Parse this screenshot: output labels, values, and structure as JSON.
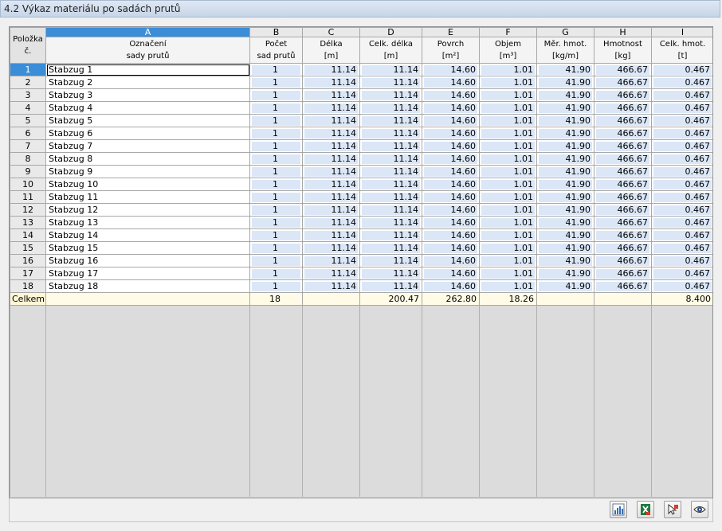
{
  "title": "4.2 Výkaz materiálu po sadách prutů",
  "columns": {
    "letters": [
      "A",
      "B",
      "C",
      "D",
      "E",
      "F",
      "G",
      "H",
      "I"
    ],
    "row_header": {
      "line1": "Položka",
      "line2": "č."
    },
    "headers": [
      {
        "line1": "Označení",
        "line2": "sady prutů"
      },
      {
        "line1": "Počet",
        "line2": "sad prutů"
      },
      {
        "line1": "Délka",
        "line2": "[m]"
      },
      {
        "line1": "Celk. délka",
        "line2": "[m]"
      },
      {
        "line1": "Povrch",
        "line2": "[m²]"
      },
      {
        "line1": "Objem",
        "line2": "[m³]"
      },
      {
        "line1": "Měr. hmot.",
        "line2": "[kg/m]"
      },
      {
        "line1": "Hmotnost",
        "line2": "[kg]"
      },
      {
        "line1": "Celk. hmot.",
        "line2": "[t]"
      }
    ]
  },
  "rows": [
    {
      "no": "1",
      "name": "Stabzug 1",
      "count": "1",
      "length": "11.14",
      "total_length": "11.14",
      "surface": "14.60",
      "volume": "1.01",
      "unit_weight": "41.90",
      "weight": "466.67",
      "total_weight": "0.467"
    },
    {
      "no": "2",
      "name": "Stabzug 2",
      "count": "1",
      "length": "11.14",
      "total_length": "11.14",
      "surface": "14.60",
      "volume": "1.01",
      "unit_weight": "41.90",
      "weight": "466.67",
      "total_weight": "0.467"
    },
    {
      "no": "3",
      "name": "Stabzug 3",
      "count": "1",
      "length": "11.14",
      "total_length": "11.14",
      "surface": "14.60",
      "volume": "1.01",
      "unit_weight": "41.90",
      "weight": "466.67",
      "total_weight": "0.467"
    },
    {
      "no": "4",
      "name": "Stabzug 4",
      "count": "1",
      "length": "11.14",
      "total_length": "11.14",
      "surface": "14.60",
      "volume": "1.01",
      "unit_weight": "41.90",
      "weight": "466.67",
      "total_weight": "0.467"
    },
    {
      "no": "5",
      "name": "Stabzug 5",
      "count": "1",
      "length": "11.14",
      "total_length": "11.14",
      "surface": "14.60",
      "volume": "1.01",
      "unit_weight": "41.90",
      "weight": "466.67",
      "total_weight": "0.467"
    },
    {
      "no": "6",
      "name": "Stabzug 6",
      "count": "1",
      "length": "11.14",
      "total_length": "11.14",
      "surface": "14.60",
      "volume": "1.01",
      "unit_weight": "41.90",
      "weight": "466.67",
      "total_weight": "0.467"
    },
    {
      "no": "7",
      "name": "Stabzug 7",
      "count": "1",
      "length": "11.14",
      "total_length": "11.14",
      "surface": "14.60",
      "volume": "1.01",
      "unit_weight": "41.90",
      "weight": "466.67",
      "total_weight": "0.467"
    },
    {
      "no": "8",
      "name": "Stabzug 8",
      "count": "1",
      "length": "11.14",
      "total_length": "11.14",
      "surface": "14.60",
      "volume": "1.01",
      "unit_weight": "41.90",
      "weight": "466.67",
      "total_weight": "0.467"
    },
    {
      "no": "9",
      "name": "Stabzug 9",
      "count": "1",
      "length": "11.14",
      "total_length": "11.14",
      "surface": "14.60",
      "volume": "1.01",
      "unit_weight": "41.90",
      "weight": "466.67",
      "total_weight": "0.467"
    },
    {
      "no": "10",
      "name": "Stabzug 10",
      "count": "1",
      "length": "11.14",
      "total_length": "11.14",
      "surface": "14.60",
      "volume": "1.01",
      "unit_weight": "41.90",
      "weight": "466.67",
      "total_weight": "0.467"
    },
    {
      "no": "11",
      "name": "Stabzug 11",
      "count": "1",
      "length": "11.14",
      "total_length": "11.14",
      "surface": "14.60",
      "volume": "1.01",
      "unit_weight": "41.90",
      "weight": "466.67",
      "total_weight": "0.467"
    },
    {
      "no": "12",
      "name": "Stabzug 12",
      "count": "1",
      "length": "11.14",
      "total_length": "11.14",
      "surface": "14.60",
      "volume": "1.01",
      "unit_weight": "41.90",
      "weight": "466.67",
      "total_weight": "0.467"
    },
    {
      "no": "13",
      "name": "Stabzug 13",
      "count": "1",
      "length": "11.14",
      "total_length": "11.14",
      "surface": "14.60",
      "volume": "1.01",
      "unit_weight": "41.90",
      "weight": "466.67",
      "total_weight": "0.467"
    },
    {
      "no": "14",
      "name": "Stabzug 14",
      "count": "1",
      "length": "11.14",
      "total_length": "11.14",
      "surface": "14.60",
      "volume": "1.01",
      "unit_weight": "41.90",
      "weight": "466.67",
      "total_weight": "0.467"
    },
    {
      "no": "15",
      "name": "Stabzug 15",
      "count": "1",
      "length": "11.14",
      "total_length": "11.14",
      "surface": "14.60",
      "volume": "1.01",
      "unit_weight": "41.90",
      "weight": "466.67",
      "total_weight": "0.467"
    },
    {
      "no": "16",
      "name": "Stabzug 16",
      "count": "1",
      "length": "11.14",
      "total_length": "11.14",
      "surface": "14.60",
      "volume": "1.01",
      "unit_weight": "41.90",
      "weight": "466.67",
      "total_weight": "0.467"
    },
    {
      "no": "17",
      "name": "Stabzug 17",
      "count": "1",
      "length": "11.14",
      "total_length": "11.14",
      "surface": "14.60",
      "volume": "1.01",
      "unit_weight": "41.90",
      "weight": "466.67",
      "total_weight": "0.467"
    },
    {
      "no": "18",
      "name": "Stabzug 18",
      "count": "1",
      "length": "11.14",
      "total_length": "11.14",
      "surface": "14.60",
      "volume": "1.01",
      "unit_weight": "41.90",
      "weight": "466.67",
      "total_weight": "0.467"
    }
  ],
  "total": {
    "label": "Celkem",
    "count": "18",
    "total_length": "200.47",
    "surface": "262.80",
    "volume": "18.26",
    "total_weight": "8.400"
  },
  "toolbar": {
    "buttons": [
      {
        "icon": "column-chart-icon"
      },
      {
        "icon": "excel-export-icon"
      },
      {
        "icon": "select-member-icon"
      },
      {
        "icon": "view-eye-icon"
      }
    ]
  },
  "colors": {
    "selection": "#3c8dd8",
    "cell_fill": "#dbe7f7",
    "total_fill": "#fffbe6"
  }
}
